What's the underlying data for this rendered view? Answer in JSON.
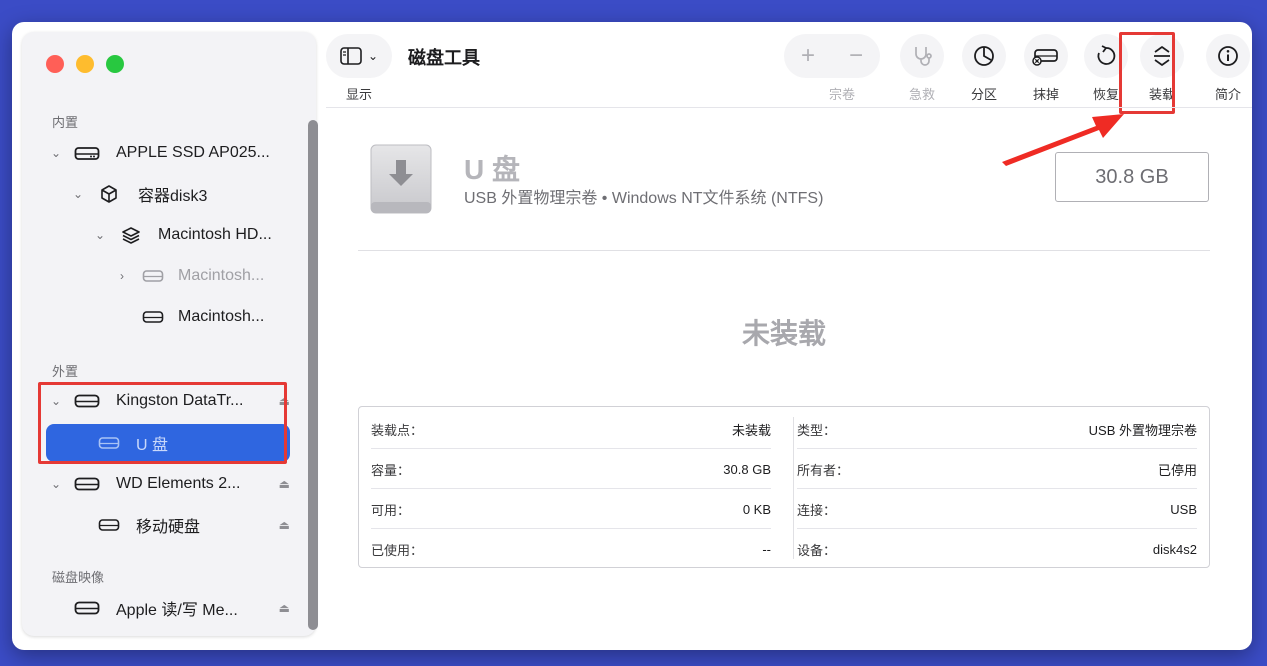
{
  "app": {
    "title": "磁盘工具",
    "view_label": "显示"
  },
  "toolbar": {
    "add": "+",
    "remove": "−",
    "volume_label": "宗卷",
    "first_aid_label": "急救",
    "partition_label": "分区",
    "erase_label": "抹掉",
    "restore_label": "恢复",
    "mount_label": "装载",
    "info_label": "简介"
  },
  "sidebar": {
    "section_internal": "内置",
    "section_external": "外置",
    "section_images": "磁盘映像",
    "items": [
      {
        "label": "APPLE SSD AP025..."
      },
      {
        "label": "容器disk3"
      },
      {
        "label": "Macintosh HD..."
      },
      {
        "label": "Macintosh..."
      },
      {
        "label": "Macintosh..."
      },
      {
        "label": "Kingston DataTr..."
      },
      {
        "label": "U 盘"
      },
      {
        "label": "WD Elements 2..."
      },
      {
        "label": "移动硬盘"
      },
      {
        "label": "Apple 读/写 Me..."
      }
    ]
  },
  "disk": {
    "name": "U 盘",
    "subtitle": "USB 外置物理宗卷 • Windows NT文件系统 (NTFS)",
    "size": "30.8 GB",
    "status": "未装载"
  },
  "info": {
    "left": [
      {
        "key": "装载点：",
        "value": "未装载"
      },
      {
        "key": "容量：",
        "value": "30.8 GB"
      },
      {
        "key": "可用：",
        "value": "0 KB"
      },
      {
        "key": "已使用：",
        "value": "--"
      }
    ],
    "right": [
      {
        "key": "类型：",
        "value": "USB 外置物理宗卷"
      },
      {
        "key": "所有者：",
        "value": "已停用"
      },
      {
        "key": "连接：",
        "value": "USB"
      },
      {
        "key": "设备：",
        "value": "disk4s2"
      }
    ]
  },
  "colors": {
    "selection": "#2f66e0",
    "highlight": "#e53935",
    "background": "#3b4cc6"
  }
}
